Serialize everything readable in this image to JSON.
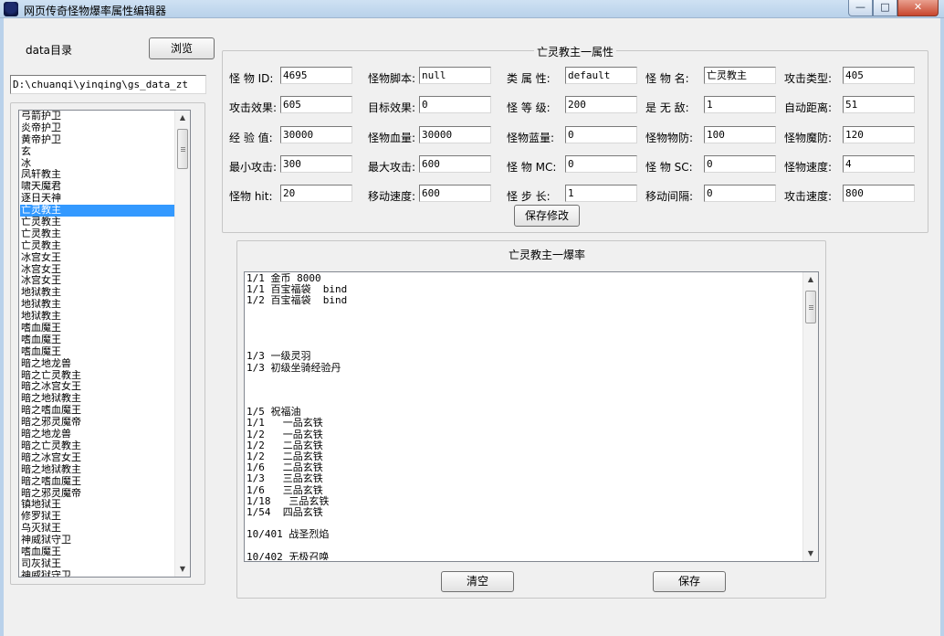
{
  "window": {
    "title": "网页传奇怪物爆率属性编辑器",
    "min_label": "—",
    "max_label": "□",
    "close_label": "✕"
  },
  "left": {
    "data_dir_label": "data目录",
    "browse_label": "浏览",
    "path_value": "D:\\chuanqi\\yinqing\\gs_data_zt",
    "monsters": [
      "弓箭护卫",
      "炎帝护卫",
      "黄帝护卫",
      "玄",
      "冰",
      "凤轩教主",
      "啸天魔君",
      "逐日天神",
      "亡灵教主",
      "亡灵教主",
      "亡灵教主",
      "亡灵教主",
      "冰宫女王",
      "冰宫女王",
      "冰宫女王",
      "地狱教主",
      "地狱教主",
      "地狱教主",
      "嗜血魔王",
      "嗜血魔王",
      "嗜血魔王",
      "暗之地龙兽",
      "暗之亡灵教主",
      "暗之冰宫女王",
      "暗之地狱教主",
      "暗之嗜血魔王",
      "暗之邪灵魔帝",
      "暗之地龙兽",
      "暗之亡灵教主",
      "暗之冰宫女王",
      "暗之地狱教主",
      "暗之嗜血魔王",
      "暗之邪灵魔帝",
      "镇地狱王",
      "修罗狱王",
      "乌灭狱王",
      "神威狱守卫",
      "嗜血魔王",
      "司灰狱王",
      "神威狱守卫"
    ],
    "selected_index": 8
  },
  "attributes": {
    "title": "亡灵教主一属性",
    "fields": [
      {
        "label": "怪 物 ID:",
        "value": "4695"
      },
      {
        "label": "怪物脚本:",
        "value": "null"
      },
      {
        "label": "类 属 性:",
        "value": "default"
      },
      {
        "label": "怪 物 名:",
        "value": "亡灵教主"
      },
      {
        "label": "攻击类型:",
        "value": "405"
      },
      {
        "label": "攻击效果:",
        "value": "605"
      },
      {
        "label": "目标效果:",
        "value": "0"
      },
      {
        "label": "怪 等 级:",
        "value": "200"
      },
      {
        "label": "是 无 敌:",
        "value": "1"
      },
      {
        "label": "自动距离:",
        "value": "51"
      },
      {
        "label": "经 验 值:",
        "value": "30000"
      },
      {
        "label": "怪物血量:",
        "value": "30000"
      },
      {
        "label": "怪物蓝量:",
        "value": "0"
      },
      {
        "label": "怪物物防:",
        "value": "100"
      },
      {
        "label": "怪物魔防:",
        "value": "120"
      },
      {
        "label": "最小攻击:",
        "value": "300"
      },
      {
        "label": "最大攻击:",
        "value": "600"
      },
      {
        "label": "怪 物 MC:",
        "value": "0"
      },
      {
        "label": "怪 物 SC:",
        "value": "0"
      },
      {
        "label": "怪物速度:",
        "value": "4"
      },
      {
        "label": "怪物 hit:",
        "value": "20"
      },
      {
        "label": "移动速度:",
        "value": "600"
      },
      {
        "label": "怪 步 长:",
        "value": "1"
      },
      {
        "label": "移动间隔:",
        "value": "0"
      },
      {
        "label": "攻击速度:",
        "value": "800"
      }
    ],
    "save_label": "保存修改"
  },
  "drops": {
    "title": "亡灵教主一爆率",
    "lines": [
      "1/1 金币 8000",
      "1/1 百宝福袋  bind",
      "1/2 百宝福袋  bind",
      "",
      "",
      "",
      "",
      "1/3 一级灵羽",
      "1/3 初级坐骑经验丹",
      "",
      "",
      "",
      "1/5 祝福油",
      "1/1   一品玄铁",
      "1/2   一品玄铁",
      "1/2   二品玄铁",
      "1/2   二品玄铁",
      "1/6   二品玄铁",
      "1/3   三品玄铁",
      "1/6   三品玄铁",
      "1/18   三品玄铁",
      "1/54  四品玄铁",
      "",
      "10/401 战圣烈焰",
      "",
      "10/402 无极召唤"
    ],
    "clear_label": "清空",
    "save_label": "保存"
  }
}
